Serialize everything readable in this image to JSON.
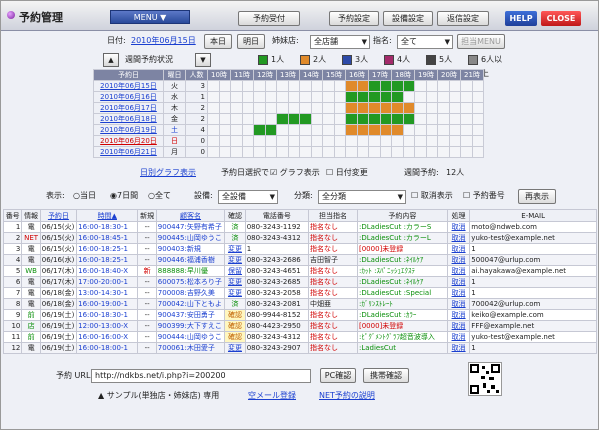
{
  "header": {
    "title": "予約管理",
    "menu": "MENU ▼",
    "buttons": [
      "予約受付",
      "予約設定",
      "設備設定",
      "返信設定"
    ],
    "help": "HELP",
    "close": "CLOSE"
  },
  "filter": {
    "date_label": "日付:",
    "date_value": "2010年06月15日",
    "today": "本日",
    "tomorrow": "明日",
    "shop_label": "姉妹店:",
    "shop_value": "全店舗",
    "staff_label": "指名:",
    "staff_value": "全て",
    "staff_menu": "担当MENU"
  },
  "week": {
    "title": "週間予約状況",
    "headers": {
      "date": "予約日",
      "dow": "曜日",
      "count": "人数"
    },
    "hours": [
      "10時",
      "11時",
      "12時",
      "13時",
      "14時",
      "15時",
      "16時",
      "17時",
      "18時",
      "19時",
      "20時",
      "21時"
    ],
    "legend": [
      "1人",
      "2人",
      "3人",
      "4人",
      "5人",
      "6人以上"
    ],
    "legend_colors": [
      "#229922",
      "#e08a2a",
      "#2d4aa8",
      "#a32a6a",
      "#444444",
      "#888888"
    ],
    "days": [
      {
        "date": "2010年06月15日",
        "dow": "火",
        "count": "3",
        "color": "#1a3fd0"
      },
      {
        "date": "2010年06月16日",
        "dow": "水",
        "count": "1",
        "color": "#1a3fd0"
      },
      {
        "date": "2010年06月17日",
        "dow": "木",
        "count": "2",
        "color": "#1a3fd0"
      },
      {
        "date": "2010年06月18日",
        "dow": "金",
        "count": "2",
        "color": "#1a3fd0"
      },
      {
        "date": "2010年06月19日",
        "dow": "土",
        "count": "4",
        "color": "#1a3fd0"
      },
      {
        "date": "2010年06月20日",
        "dow": "日",
        "count": "0",
        "color": "#d10000"
      },
      {
        "date": "2010年06月21日",
        "dow": "月",
        "count": "0",
        "color": "#1a3fd0"
      }
    ],
    "graph_link": "日別グラフ表示",
    "chk_select": "予約日選択で",
    "chk_graph": "グラフ表示",
    "chk_change": "日付変更",
    "weekly_label": "週間予約:",
    "weekly_count": "12人"
  },
  "controls": {
    "show_label": "表示:",
    "r_today": "当日",
    "r_7day": "7日間",
    "r_all": "全て",
    "equip_label": "設備:",
    "equip_value": "全設備",
    "cat_label": "分類:",
    "cat_value": "全分類",
    "cancel": "取消表示",
    "resnum": "予約番号",
    "redisplay": "再表示"
  },
  "table": {
    "headers": [
      "番号",
      "情報",
      "予約日",
      "時間▲",
      "新規",
      "顧客名",
      "確認",
      "電話番号",
      "担当指名",
      "予約内容",
      "処理",
      "E-MAIL"
    ],
    "rows": [
      [
        "1",
        "電",
        "06/15(火)",
        "16:00-18:30-1",
        "--",
        "900447:矢野有希子",
        "済",
        "080-3243-1192",
        "指名なし",
        ":DLadiesCut :カラーS",
        "取消",
        "moto@ndweb.com"
      ],
      [
        "2",
        "NET",
        "06/15(火)",
        "16:00-18:45-1",
        "--",
        "900445:山岡ゆうこ",
        "済",
        "080-3243-4312",
        "指名なし",
        ":DLadiesCut :カラーL",
        "取消",
        "yuko-test@example.net"
      ],
      [
        "3",
        "電",
        "06/15(火)",
        "16:00-18:25-1",
        "--",
        "900403:新規",
        "変更",
        "1",
        "指名なし",
        "[0000]未登録",
        "取消",
        "1"
      ],
      [
        "4",
        "電",
        "06/16(水)",
        "16:00-18:25-1",
        "--",
        "900446:福浦香樹",
        "変更",
        "080-3243-2686",
        "吉田智子",
        ":DLadiesCut :ﾈｲﾙｹｱ",
        "取消",
        "500047@urlup.com"
      ],
      [
        "5",
        "WB",
        "06/17(木)",
        "16:00-18:40-X",
        "新",
        "888888:早川優",
        "保留",
        "080-3243-4651",
        "指名なし",
        ":ｶｯﾄ :ｽﾊﾟﾆｯｼｭｴｸｽﾃ",
        "取消",
        "ai.hayakawa@example.net"
      ],
      [
        "6",
        "電",
        "06/17(木)",
        "17:00-20:00-1",
        "--",
        "600075:松本ろり子",
        "変更",
        "080-3243-2685",
        "指名なし",
        ":DLadiesCut :ﾈｲﾙｹｱ",
        "取消",
        "1"
      ],
      [
        "7",
        "電",
        "06/18(金)",
        "13:00-14:30-1",
        "--",
        "700008:吉野久美",
        "変更",
        "080-3243-2058",
        "指名なし",
        ":DLadiesCut :Special",
        "取消",
        "1"
      ],
      [
        "8",
        "電",
        "06/18(金)",
        "16:00-19:00-1",
        "--",
        "700042:山下ともよ",
        "済",
        "080-3243-2081",
        "中畑亜",
        ":ｶﾞﾘﾝｽﾄﾚｰﾄ",
        "取消",
        "700042@urlup.com"
      ],
      [
        "9",
        "前",
        "06/19(土)",
        "16:00-18:30-1",
        "--",
        "900437:安田勇子",
        "確認",
        "080-9944-8152",
        "指名なし",
        ":DLadiesCut :ｶﾗｰ",
        "取消",
        "keiko@example.com"
      ],
      [
        "10",
        "店",
        "06/19(土)",
        "12:00-13:00-X",
        "--",
        "900399:大下すえこ",
        "確認",
        "080-4423-2950",
        "指名なし",
        "[0000]未登録",
        "取消",
        "FFF@example.net"
      ],
      [
        "11",
        "前",
        "06/19(土)",
        "16:00-16:00-X",
        "--",
        "900444:山岡ゆうこ",
        "確認",
        "080-3243-4312",
        "指名なし",
        ":ﾋﾟｸﾞﾒﾝﾄｸﾞﾗﾌ超音波導入",
        "取消",
        "yuko-test@example.net"
      ],
      [
        "12",
        "電",
        "06/19(土)",
        "16:00-18:00-1",
        "--",
        "700061:木田愛子",
        "変更",
        "080-3243-2907",
        "指名なし",
        ":LadiesCut",
        "取消",
        "1"
      ]
    ]
  },
  "footer": {
    "url_label": "予約 URL:",
    "url_value": "http://ndkbs.net/i.php?i=200200",
    "pc_check": "PC確認",
    "mobile_check": "携帯確認",
    "sample": "▲ サンプル(単独店・姉妹店) 専用",
    "sample_link1": "空メール登録",
    "sample_link2": "NET予約の説明",
    "qr": "QR code"
  }
}
